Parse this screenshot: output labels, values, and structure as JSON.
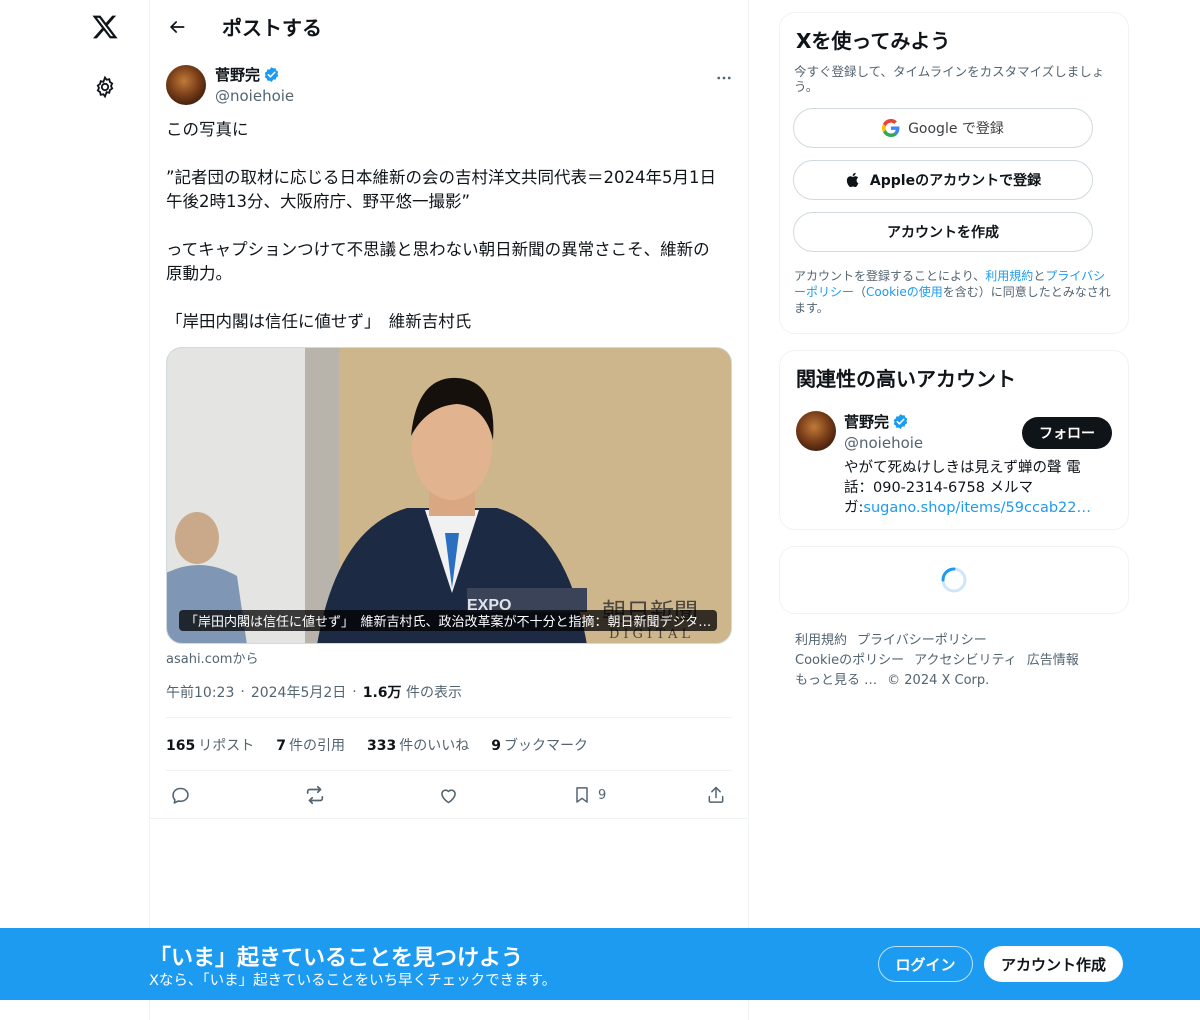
{
  "header": {
    "title": "ポストする"
  },
  "post": {
    "author_name": "菅野完",
    "author_handle": "@noiehoie",
    "text_lines": [
      "この写真に",
      "”記者団の取材に応じる日本維新の会の吉村洋文共同代表＝2024年5月1日\n午後2時13分、大阪府庁、野平悠一撮影”",
      "ってキャプションつけて不思議と思わない朝日新聞の異常さこそ、維新の\n原動力。",
      "「岸田内閣は信任に値せず」　維新吉村氏"
    ],
    "card": {
      "caption": "「岸田内閣は信任に値せず」　維新吉村氏、政治改革案が不十分と指摘：朝日新聞デジタ…",
      "source": "asahi.comから",
      "watermark": "朝日新聞",
      "watermark_sub": "DIGITAL",
      "backdrop_text": "EXPO"
    },
    "time": "午前10:23",
    "date": "2024年5月2日",
    "views_count": "1.6万",
    "views_label": "件の表示",
    "stats": [
      {
        "count": "165",
        "label": "リポスト"
      },
      {
        "count": "7",
        "label": "件の引用"
      },
      {
        "count": "333",
        "label": "件のいいね"
      },
      {
        "count": "9",
        "label": "ブックマーク"
      }
    ],
    "bookmark_count": "9"
  },
  "signup": {
    "title": "Xを使ってみよう",
    "subtitle": "今すぐ登録して、タイムラインをカスタマイズしましょう。",
    "google_button": "Google で登録",
    "apple_button": "Appleのアカウントで登録",
    "create_button": "アカウントを作成",
    "terms_prefix": "アカウントを登録することにより、",
    "terms_link1": "利用規約",
    "terms_and": "と",
    "terms_link2": "プライバシーポリシー",
    "terms_mid": "（",
    "terms_link3": "Cookieの使用",
    "terms_suffix": "を含む）に同意したとみなされます。"
  },
  "related": {
    "title": "関連性の高いアカウント",
    "name": "菅野完",
    "handle": "@noiehoie",
    "follow_label": "フォロー",
    "bio_text": "やがて死ぬけしきは見えず蝉の聲 電話：090-2314-6758 メルマガ:",
    "bio_link": "sugano.shop/items/59ccab22…"
  },
  "footer": {
    "links": [
      "利用規約",
      "プライバシーポリシー",
      "Cookieのポリシー",
      "アクセシビリティ",
      "広告情報",
      "もっと見る …",
      "© 2024 X Corp."
    ]
  },
  "bottom_bar": {
    "title": "「いま」起きていることを見つけよう",
    "subtitle": "Xなら、「いま」起きていることをいち早くチェックできます。",
    "login_label": "ログイン",
    "create_label": "アカウント作成"
  },
  "colors": {
    "accent": "#1d9bf0",
    "text": "#0f1419",
    "muted": "#536471",
    "border": "#eff3f4"
  },
  "icons": [
    "x-logo-icon",
    "gear-icon",
    "back-arrow-icon",
    "verified-icon",
    "more-icon",
    "reply-icon",
    "repost-icon",
    "like-icon",
    "bookmark-icon",
    "share-icon",
    "google-icon",
    "apple-icon",
    "loading-spinner-icon"
  ]
}
